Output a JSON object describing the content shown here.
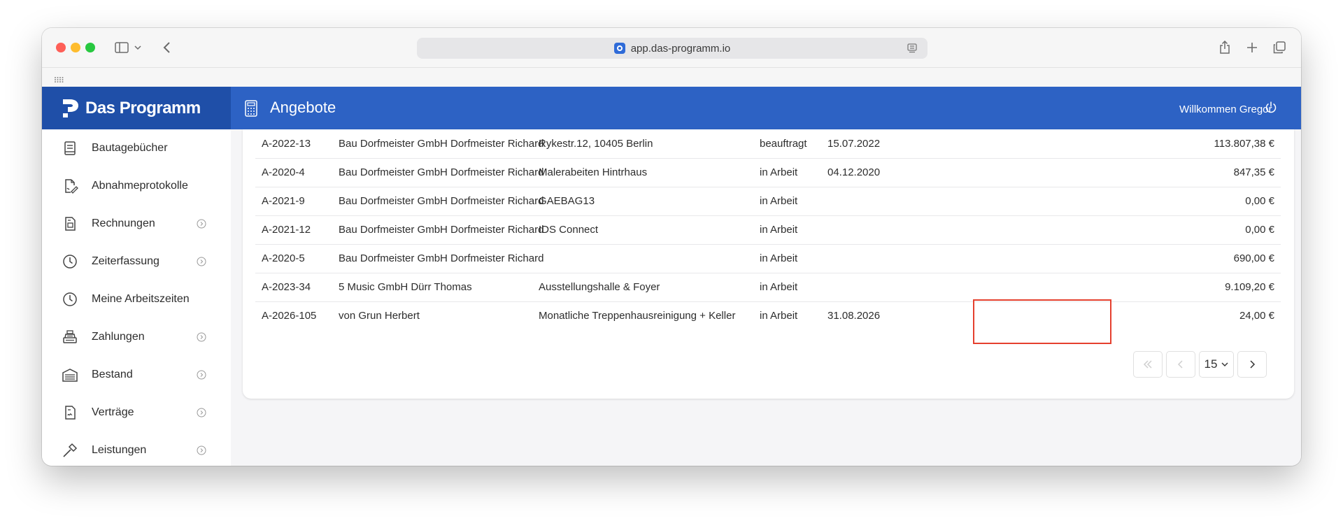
{
  "browser": {
    "url": "app.das-programm.io"
  },
  "app": {
    "logo_text": "Das Programm",
    "page_title": "Angebote",
    "welcome": "Willkommen Gregor"
  },
  "sidebar": {
    "items": [
      {
        "label": "Bautagebücher",
        "icon": "book-icon",
        "has_submenu": false
      },
      {
        "label": "Abnahmeprotokolle",
        "icon": "document-signature-icon",
        "has_submenu": false
      },
      {
        "label": "Rechnungen",
        "icon": "invoice-icon",
        "has_submenu": true
      },
      {
        "label": "Zeiterfassung",
        "icon": "clock-icon",
        "has_submenu": true
      },
      {
        "label": "Meine Arbeitszeiten",
        "icon": "clock-icon",
        "has_submenu": false
      },
      {
        "label": "Zahlungen",
        "icon": "cash-register-icon",
        "has_submenu": true
      },
      {
        "label": "Bestand",
        "icon": "warehouse-icon",
        "has_submenu": true
      },
      {
        "label": "Verträge",
        "icon": "contract-icon",
        "has_submenu": true
      },
      {
        "label": "Leistungen",
        "icon": "hammer-icon",
        "has_submenu": true
      }
    ]
  },
  "table": {
    "rows": [
      {
        "nr": "A-2022-13",
        "kunde": "Bau Dorfmeister GmbH Dorfmeister Richard",
        "bauvorhaben": "Rykestr.12, 10405 Berlin",
        "status": "beauftragt",
        "datum": "15.07.2022",
        "betrag": "113.807,38 €"
      },
      {
        "nr": "A-2020-4",
        "kunde": "Bau Dorfmeister GmbH Dorfmeister Richard",
        "bauvorhaben": "Malerabeiten Hintrhaus",
        "status": "in Arbeit",
        "datum": "04.12.2020",
        "betrag": "847,35 €"
      },
      {
        "nr": "A-2021-9",
        "kunde": "Bau Dorfmeister GmbH Dorfmeister Richard",
        "bauvorhaben": "GAEBAG13",
        "status": "in Arbeit",
        "datum": "",
        "betrag": "0,00 €"
      },
      {
        "nr": "A-2021-12",
        "kunde": "Bau Dorfmeister GmbH Dorfmeister Richard",
        "bauvorhaben": "IDS Connect",
        "status": "in Arbeit",
        "datum": "",
        "betrag": "0,00 €"
      },
      {
        "nr": "A-2020-5",
        "kunde": "Bau Dorfmeister GmbH Dorfmeister Richard",
        "bauvorhaben": "",
        "status": "in Arbeit",
        "datum": "",
        "betrag": "690,00 €"
      },
      {
        "nr": "A-2023-34",
        "kunde": "5 Music GmbH Dürr Thomas",
        "bauvorhaben": "Ausstellungshalle & Foyer",
        "status": "in Arbeit",
        "datum": "",
        "betrag": "9.109,20 €"
      },
      {
        "nr": "A-2026-105",
        "kunde": "von Grun Herbert",
        "bauvorhaben": "Monatliche Treppenhausreinigung + Keller",
        "status": "in Arbeit",
        "datum": "31.08.2026",
        "betrag": "24,00 €"
      }
    ]
  },
  "pagination": {
    "page_size": "15",
    "first_disabled": true,
    "prev_disabled": true
  },
  "colors": {
    "header": "#2d62c4",
    "logo_bg": "#1f4fa8",
    "highlight": "#e5402e"
  }
}
